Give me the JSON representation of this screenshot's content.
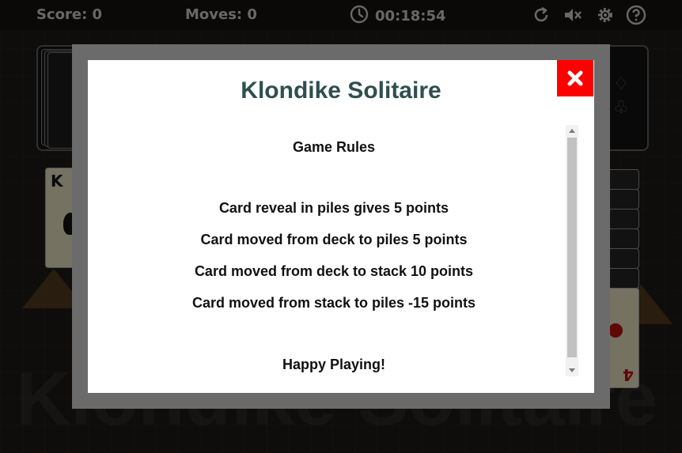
{
  "topbar": {
    "score_label": "Score: 0",
    "moves_label": "Moves: 0",
    "timer": "00:18:54",
    "icons": [
      "clock-icon",
      "restart-icon",
      "mute-icon",
      "settings-icon",
      "help-icon"
    ]
  },
  "board": {
    "watermark": "Klondike Solitaire",
    "visible_cards": [
      {
        "rank": "K",
        "suit": "spades"
      },
      {
        "rank": "4",
        "suit": "hearts"
      }
    ],
    "foundation_suits": [
      "♢",
      "♧"
    ]
  },
  "modal": {
    "title": "Klondike Solitaire",
    "close_icon": "close-icon",
    "heading": "Game Rules",
    "rules": [
      "Card reveal in piles gives 5 points",
      "Card moved from deck to piles 5 points",
      "Card moved from deck to stack 10 points",
      "Card moved from stack to piles -15 points"
    ],
    "footer": "Happy Playing!"
  },
  "colors": {
    "title": "#2f4f4f",
    "close_button": "#ff0000",
    "modal_frame": "#6b6b6b"
  }
}
